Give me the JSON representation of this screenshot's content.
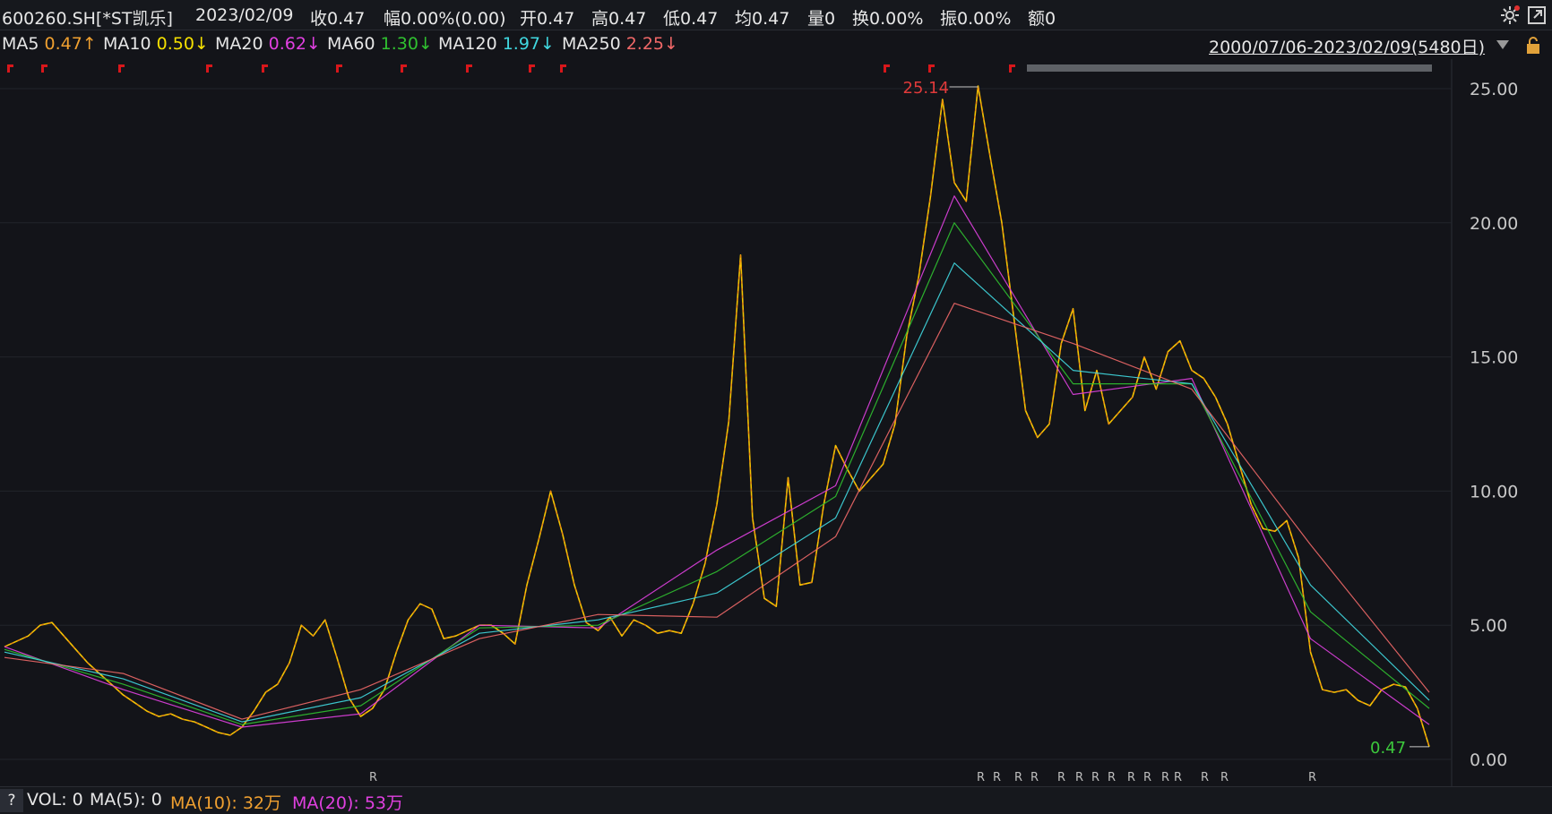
{
  "header": {
    "code": "600260.SH[*ST凯乐]",
    "date": "2023/02/09",
    "stats": [
      {
        "label": "收",
        "value": "0.47"
      },
      {
        "label": "幅",
        "value": "0.00%(0.00)"
      },
      {
        "label": "开",
        "value": "0.47"
      },
      {
        "label": "高",
        "value": "0.47"
      },
      {
        "label": "低",
        "value": "0.47"
      },
      {
        "label": "均",
        "value": "0.47"
      },
      {
        "label": "量",
        "value": "0"
      },
      {
        "label": "换",
        "value": "0.00%"
      },
      {
        "label": "振",
        "value": "0.00%"
      },
      {
        "label": "额",
        "value": "0"
      }
    ]
  },
  "ma_legend": [
    {
      "label": "MA5",
      "value": "0.47↑",
      "color": "#f0a030"
    },
    {
      "label": "MA10",
      "value": "0.50↓",
      "color": "#f5e000"
    },
    {
      "label": "MA20",
      "value": "0.62↓",
      "color": "#e040e0"
    },
    {
      "label": "MA60",
      "value": "1.30↓",
      "color": "#30c030"
    },
    {
      "label": "MA120",
      "value": "1.97↓",
      "color": "#40d8e0"
    },
    {
      "label": "MA250",
      "value": "2.25↓",
      "color": "#f06868"
    }
  ],
  "range": {
    "text": "2000/07/06-2023/02/09(5480日)"
  },
  "chart_data": {
    "type": "line",
    "y_ticks": [
      "25.00",
      "20.00",
      "15.00",
      "10.00",
      "5.00",
      "0.00"
    ],
    "ylim": [
      0,
      25.5
    ],
    "annotations": {
      "high": "25.14",
      "low": "0.47"
    },
    "r_markers": "R",
    "series": [
      {
        "color": "#f5c400",
        "x": [
          0,
          1,
          2,
          3,
          4,
          5,
          6,
          7,
          8,
          9,
          10,
          11,
          12,
          13,
          14,
          15,
          16,
          17,
          18,
          19,
          20,
          21,
          22,
          23,
          24,
          25,
          26,
          27,
          28,
          29,
          30,
          31,
          32,
          33,
          34,
          35,
          36,
          37,
          38,
          39,
          40,
          41,
          42,
          43,
          44,
          45,
          46,
          47,
          48,
          49,
          50,
          51,
          52,
          53,
          54,
          55,
          56,
          57,
          58,
          59,
          60,
          61,
          62,
          63,
          64,
          65,
          66,
          67,
          68,
          69,
          70,
          71,
          72,
          73,
          74,
          75,
          76,
          77,
          78,
          79,
          80,
          81,
          82,
          83,
          84,
          85,
          86,
          87,
          88,
          89,
          90,
          91,
          92,
          93,
          94,
          95,
          96,
          97,
          98,
          99,
          100,
          101,
          102,
          103,
          104,
          105,
          106,
          107,
          108,
          109,
          110,
          111,
          112,
          113,
          114,
          115,
          116,
          117,
          118,
          119,
          120
        ],
        "values": [
          4.2,
          4.4,
          4.6,
          5.0,
          5.1,
          4.6,
          4.1,
          3.6,
          3.2,
          2.8,
          2.4,
          2.1,
          1.8,
          1.6,
          1.7,
          1.5,
          1.4,
          1.2,
          1.0,
          0.9,
          1.2,
          1.8,
          2.5,
          2.8,
          3.6,
          5.0,
          4.6,
          5.2,
          3.8,
          2.3,
          1.6,
          1.9,
          2.6,
          4.0,
          5.2,
          5.8,
          5.6,
          4.5,
          4.6,
          4.8,
          5.0,
          5.0,
          4.7,
          4.3,
          6.5,
          8.2,
          10.0,
          8.4,
          6.5,
          5.1,
          4.8,
          5.3,
          4.6,
          5.2,
          5.0,
          4.7,
          4.8,
          4.7,
          5.8,
          7.3,
          9.5,
          12.6,
          18.8,
          9.0,
          6.0,
          5.7,
          10.5,
          6.5,
          6.6,
          9.5,
          11.7,
          10.8,
          10.0,
          10.5,
          11.0,
          12.5,
          15.8,
          18.0,
          21.0,
          24.6,
          21.5,
          20.8,
          25.1,
          22.5,
          20.0,
          16.5,
          13.0,
          12.0,
          12.5,
          15.5,
          16.8,
          13.0,
          14.5,
          12.5,
          13.0,
          13.5,
          15.0,
          13.8,
          15.2,
          15.6,
          14.5,
          14.2,
          13.5,
          12.5,
          11.0,
          9.5,
          8.6,
          8.5,
          8.9,
          7.5,
          4.0,
          2.6,
          2.5,
          2.6,
          2.2,
          2.0,
          2.6,
          2.8,
          2.7,
          1.9,
          0.47
        ]
      },
      {
        "color": "#e040e0",
        "x": [
          0,
          10,
          20,
          30,
          40,
          50,
          60,
          70,
          80,
          90,
          100,
          110,
          120
        ],
        "values": [
          4.2,
          2.6,
          1.2,
          1.7,
          5.0,
          4.9,
          7.8,
          10.2,
          21.0,
          13.6,
          14.2,
          4.5,
          1.3
        ]
      },
      {
        "color": "#30c030",
        "x": [
          0,
          10,
          20,
          30,
          40,
          50,
          60,
          70,
          80,
          90,
          100,
          110,
          120
        ],
        "values": [
          4.1,
          2.8,
          1.3,
          2.0,
          4.9,
          5.0,
          7.0,
          9.8,
          20.0,
          14.0,
          14.0,
          5.5,
          1.9
        ]
      },
      {
        "color": "#40d8e0",
        "x": [
          0,
          10,
          20,
          30,
          40,
          50,
          60,
          70,
          80,
          90,
          100,
          110,
          120
        ],
        "values": [
          4.0,
          3.0,
          1.4,
          2.3,
          4.7,
          5.2,
          6.2,
          9.0,
          18.5,
          14.5,
          14.0,
          6.5,
          2.2
        ]
      },
      {
        "color": "#f06868",
        "x": [
          0,
          10,
          20,
          30,
          40,
          50,
          60,
          70,
          80,
          90,
          100,
          110,
          120
        ],
        "values": [
          3.8,
          3.2,
          1.5,
          2.6,
          4.5,
          5.4,
          5.3,
          8.3,
          17.0,
          15.5,
          13.8,
          8.0,
          2.5
        ]
      }
    ]
  },
  "volume": {
    "help": "?",
    "vol": "VOL: 0",
    "ma5": "MA(5): 0",
    "ma10": "MA(10): 32万",
    "ma20": "MA(20): 53万",
    "ma10_color": "#f0a030",
    "ma20_color": "#e040e0"
  }
}
